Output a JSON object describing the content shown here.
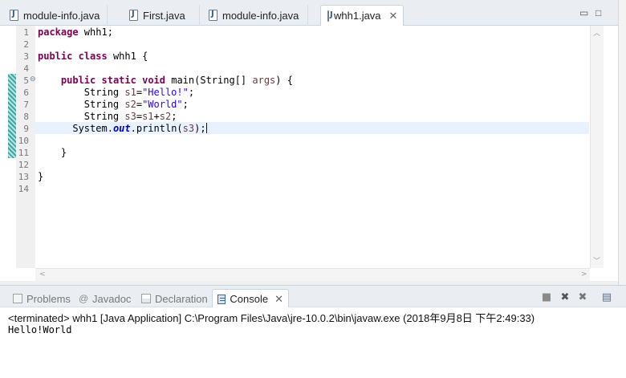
{
  "editor_tabs": [
    {
      "label": "module-info.java",
      "active": false
    },
    {
      "label": "First.java",
      "active": false
    },
    {
      "label": "module-info.java",
      "active": false
    },
    {
      "label": "whh1.java",
      "active": true
    }
  ],
  "editor_tab_close_glyph": "✕",
  "window_controls": {
    "minimize": "▭",
    "maximize": "□"
  },
  "line_numbers": [
    "1",
    "2",
    "3",
    "4",
    "5",
    "6",
    "7",
    "8",
    "9",
    "10",
    "11",
    "12",
    "13",
    "14"
  ],
  "fold_marker": "⊖",
  "code": {
    "l1_kw": "package",
    "l1_rest": " whh1;",
    "l3_kw1": "public",
    "l3_kw2": "class",
    "l3_rest": " whh1 {",
    "l5_kw1": "public",
    "l5_kw2": "static",
    "l5_kw3": "void",
    "l5_rest1": " main(String[] ",
    "l5_param": "args",
    "l5_rest2": ") {",
    "l6_pre": "String ",
    "l6_var": "s1",
    "l6_eq": "=",
    "l6_str": "\"Hello!\"",
    "l6_end": ";",
    "l7_pre": "String ",
    "l7_var": "s2",
    "l7_eq": "=",
    "l7_str": "\"World\"",
    "l7_end": ";",
    "l8_pre": "String ",
    "l8_var": "s3",
    "l8_eq": "=",
    "l8_a": "s1",
    "l8_plus": "+",
    "l8_b": "s2",
    "l8_end": ";",
    "l9_pre": "System.",
    "l9_field": "out",
    "l9_mid": ".println(",
    "l9_arg": "s3",
    "l9_end": ");",
    "l11": "}",
    "l13": "}"
  },
  "scroll_glyphs": {
    "up": "︿",
    "down": "﹀",
    "left": "<",
    "right": ">"
  },
  "view_tabs": {
    "problems": "Problems",
    "javadoc": "Javadoc",
    "javadoc_glyph": "@",
    "declaration": "Declaration",
    "console": "Console",
    "console_close": "✕"
  },
  "console_toolbar": {
    "terminate": "■",
    "remove_launch": "✖",
    "remove_all": "✖",
    "pin": "▤"
  },
  "console": {
    "status": "<terminated> whh1 [Java Application] C:\\Program Files\\Java\\jre-10.0.2\\bin\\javaw.exe (2018年9月8日 下午2:49:33)",
    "output": "Hello!World"
  },
  "colors": {
    "keyword": "#7f0055",
    "string": "#2a00ff",
    "local_var": "#6a3e3e",
    "static_field": "#0000c0",
    "current_line": "#e8f2fe"
  }
}
